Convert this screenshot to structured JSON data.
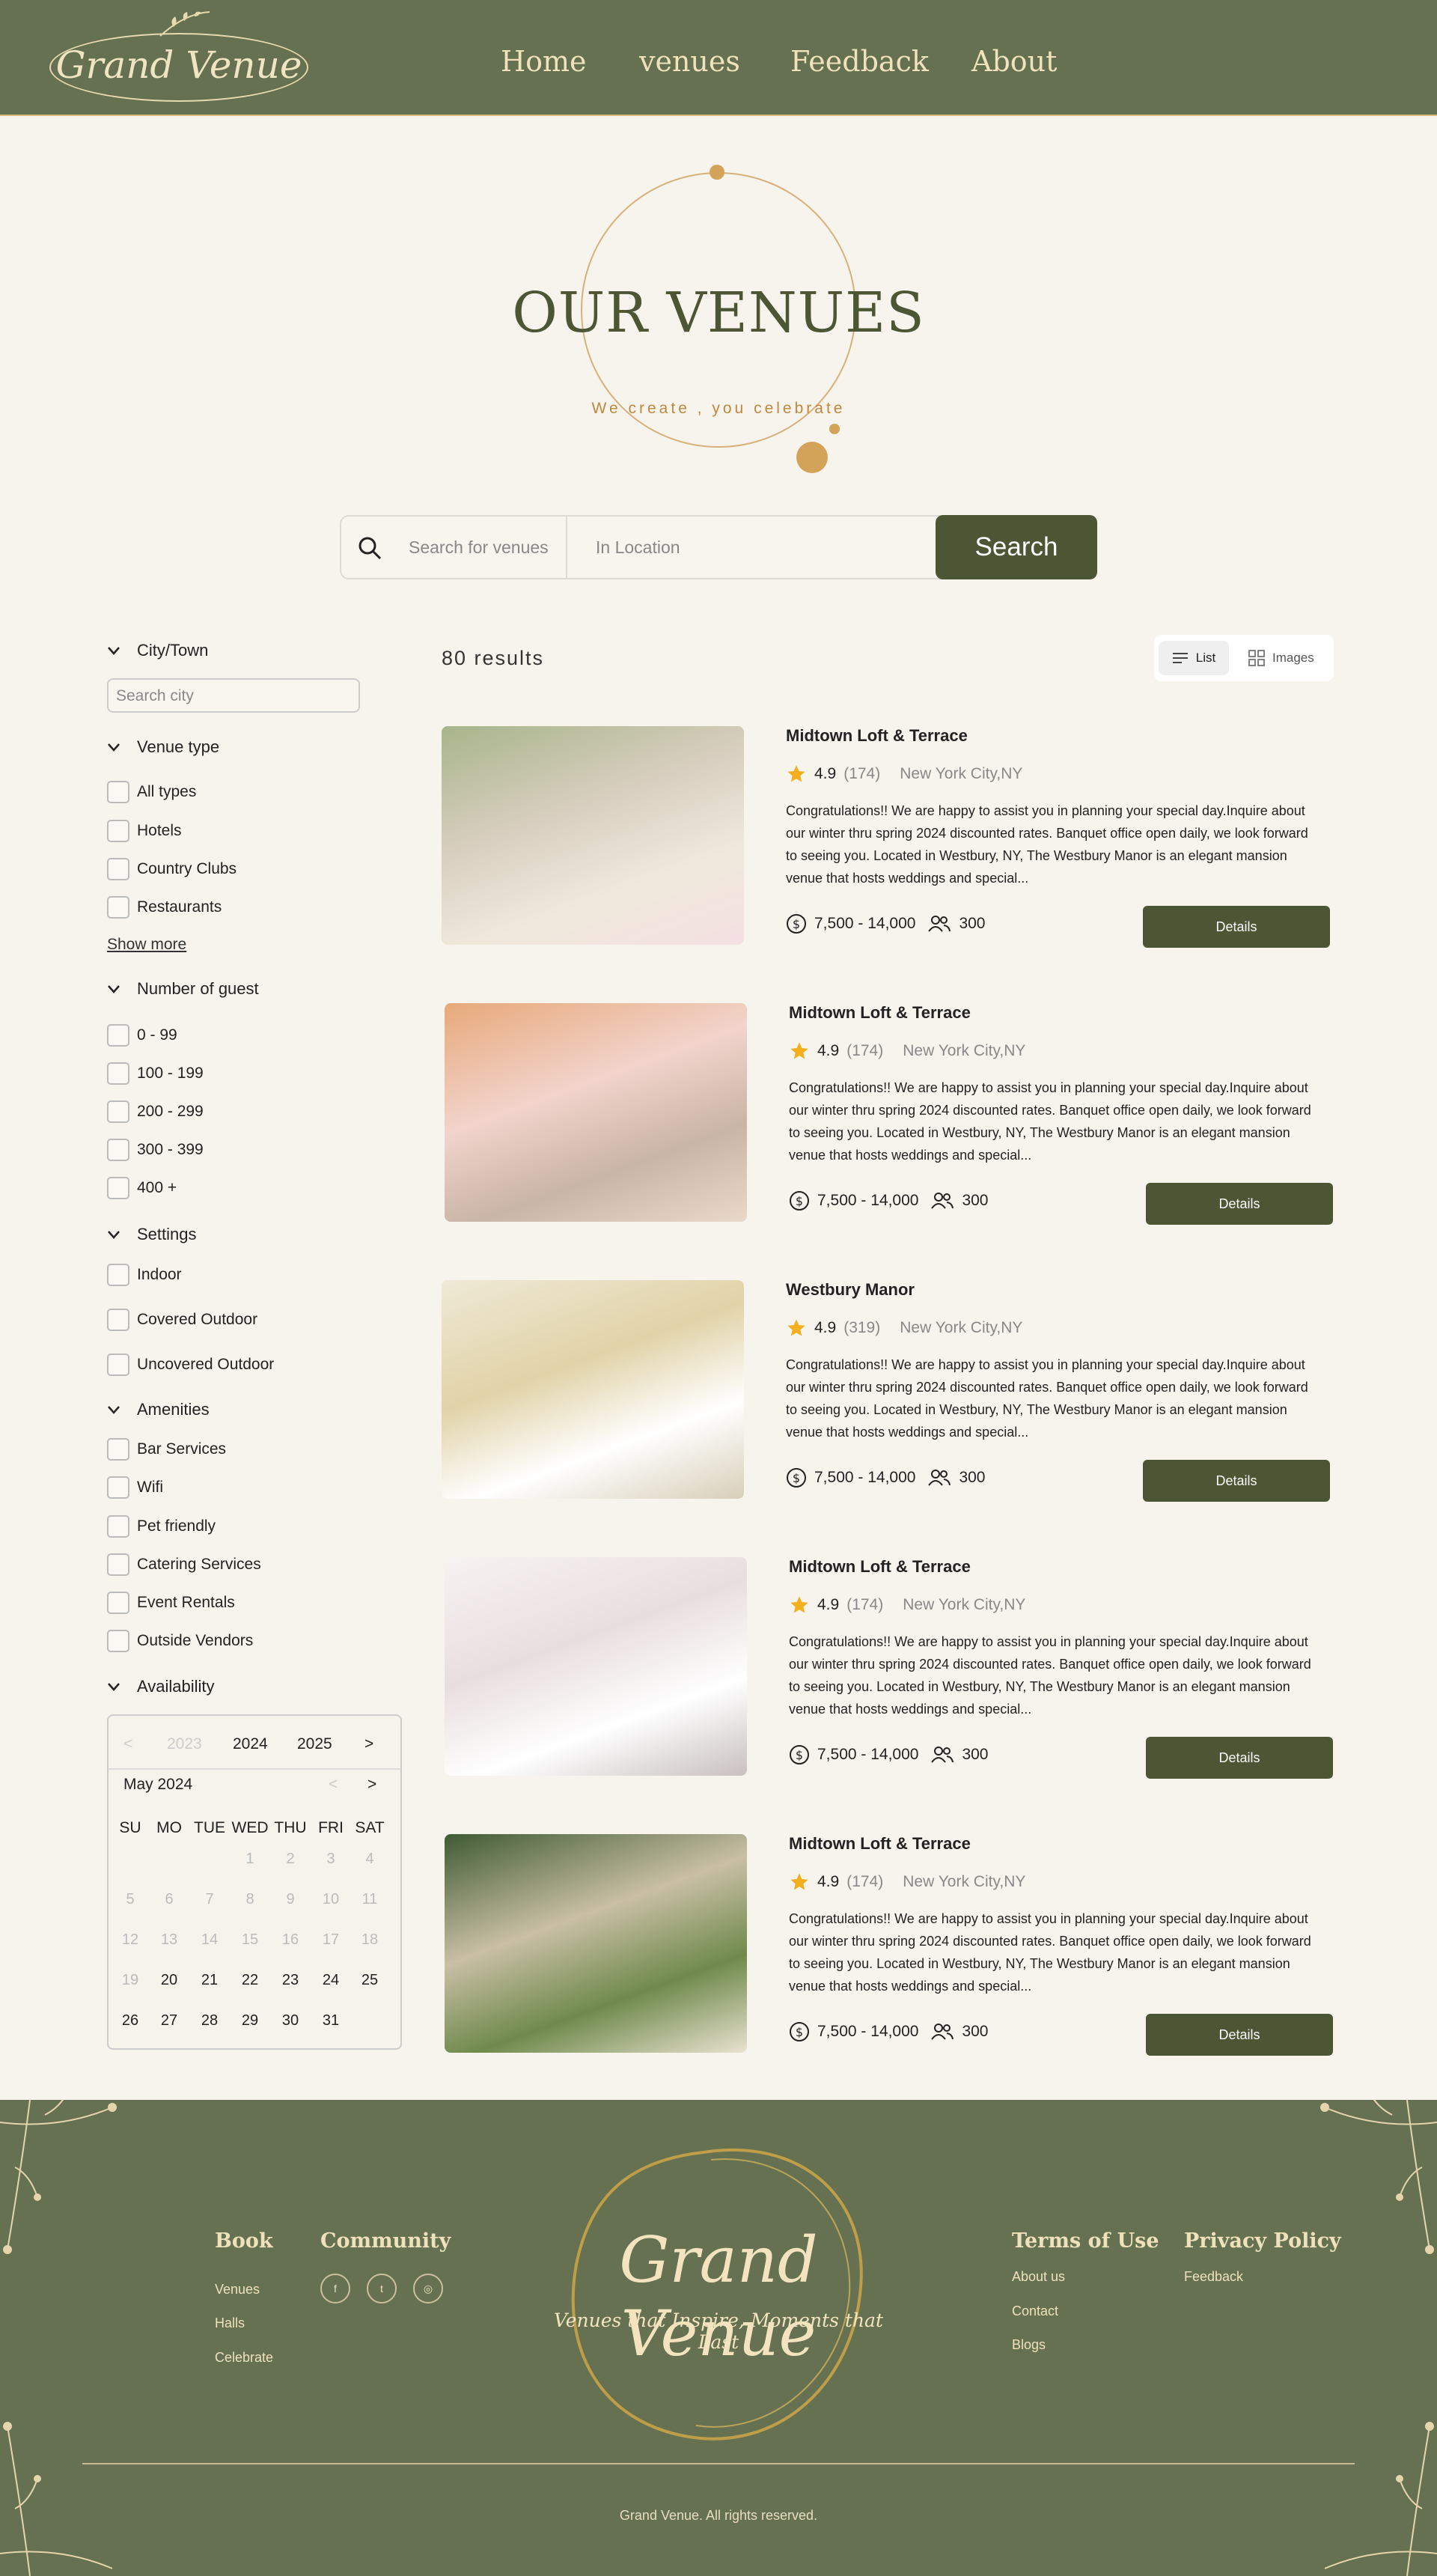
{
  "brand": {
    "name": "Grand Venue"
  },
  "nav": [
    "Home",
    "venues",
    "Feedback",
    "About"
  ],
  "hero": {
    "title": "OUR VENUES",
    "subtitle": "We create , you celebrate"
  },
  "search": {
    "venue_placeholder": "Search for venues",
    "location_placeholder": "In Location",
    "button": "Search"
  },
  "filters": {
    "city": {
      "title": "City/Town",
      "placeholder": "Search city"
    },
    "venue_type": {
      "title": "Venue type",
      "options": [
        "All types",
        "Hotels",
        "Country Clubs",
        "Restaurants"
      ],
      "show_more": "Show more"
    },
    "guests": {
      "title": "Number of guest",
      "options": [
        "0  -  99",
        "100  -  199",
        "200  -  299",
        "300  -  399",
        "400 +"
      ]
    },
    "settings": {
      "title": "Settings",
      "options": [
        "Indoor",
        "Covered Outdoor",
        "Uncovered Outdoor"
      ]
    },
    "amenities": {
      "title": "Amenities",
      "options": [
        "Bar Services",
        "Wifi",
        "Pet friendly",
        "Catering Services",
        "Event Rentals",
        "Outside Vendors"
      ]
    },
    "availability": {
      "title": "Availability"
    }
  },
  "calendar": {
    "years": [
      "2023",
      "2024",
      "2025"
    ],
    "month": "May 2024",
    "weekdays": [
      "SU",
      "MO",
      "TUE",
      "WED",
      "THU",
      "FRI",
      "SAT"
    ],
    "days": [
      [
        "",
        "",
        "",
        "1",
        "2",
        "3",
        "4"
      ],
      [
        "5",
        "6",
        "7",
        "8",
        "9",
        "10",
        "11"
      ],
      [
        "12",
        "13",
        "14",
        "15",
        "16",
        "17",
        "18"
      ],
      [
        "19",
        "20",
        "21",
        "22",
        "23",
        "24",
        "25"
      ],
      [
        "26",
        "27",
        "28",
        "29",
        "30",
        "31",
        ""
      ]
    ],
    "first_available_day": 20
  },
  "results": {
    "count": "80 results",
    "view_list": "List",
    "view_images": "Images",
    "venues": [
      {
        "name": "Midtown Loft & Terrace",
        "rating": "4.9",
        "reviews": "(174)",
        "location": "New York City,NY",
        "description": "Congratulations!! We are happy to assist you in planning your special day.Inquire about our winter thru spring 2024 discounted rates. Banquet office open daily, we look forward to seeing you. Located in Westbury, NY, The Westbury Manor is an elegant mansion venue that hosts weddings and special...",
        "price": "7,500 - 14,000",
        "capacity": "300",
        "button": "Details"
      },
      {
        "name": "Midtown Loft & Terrace",
        "rating": "4.9",
        "reviews": "(174)",
        "location": "New York City,NY",
        "description": "Congratulations!! We are happy to assist you in planning your special day.Inquire about our winter thru spring 2024 discounted rates. Banquet office open daily, we look forward to seeing you. Located in Westbury, NY, The Westbury Manor is an elegant mansion venue that hosts weddings and special...",
        "price": "7,500 - 14,000",
        "capacity": "300",
        "button": "Details"
      },
      {
        "name": "Westbury Manor",
        "rating": "4.9",
        "reviews": "(319)",
        "location": "New York City,NY",
        "description": "Congratulations!! We are happy to assist you in planning your special day.Inquire about our winter thru spring 2024 discounted rates. Banquet office open daily, we look forward to seeing you. Located in Westbury, NY, The Westbury Manor is an elegant mansion venue that hosts weddings and special...",
        "price": "7,500 - 14,000",
        "capacity": "300",
        "button": "Details"
      },
      {
        "name": "Midtown Loft & Terrace",
        "rating": "4.9",
        "reviews": "(174)",
        "location": "New York City,NY",
        "description": "Congratulations!! We are happy to assist you in planning your special day.Inquire about our winter thru spring 2024 discounted rates. Banquet office open daily, we look forward to seeing you. Located in Westbury, NY, The Westbury Manor is an elegant mansion venue that hosts weddings and special...",
        "price": "7,500 - 14,000",
        "capacity": "300",
        "button": "Details"
      },
      {
        "name": "Midtown Loft & Terrace",
        "rating": "4.9",
        "reviews": "(174)",
        "location": "New York City,NY",
        "description": "Congratulations!! We are happy to assist you in planning your special day.Inquire about our winter thru spring 2024 discounted rates. Banquet office open daily, we look forward to seeing you. Located in Westbury, NY, The Westbury Manor is an elegant mansion venue that hosts weddings and special...",
        "price": "7,500 - 14,000",
        "capacity": "300",
        "button": "Details"
      }
    ]
  },
  "footer": {
    "book": {
      "title": "Book",
      "links": [
        "Venues",
        "Halls",
        "Celebrate"
      ]
    },
    "community": {
      "title": "Community",
      "social": [
        "f",
        "t",
        "◎"
      ]
    },
    "logo": {
      "name": "Grand Venue",
      "tagline": "Venues that Inspire, Moments that Last"
    },
    "terms": {
      "title": "Terms of Use",
      "links": [
        "About us",
        "Contact",
        "Blogs"
      ]
    },
    "privacy": {
      "title": "Privacy Policy",
      "links": [
        "Feedback"
      ]
    },
    "copyright": "Grand Venue. All rights reserved."
  },
  "colors": {
    "brand_green": "#657151",
    "dark_green": "#4c5634",
    "gold": "#d4a35a",
    "cream": "#f6f4ec",
    "star": "#f2b01e"
  },
  "icons": [
    "search-icon",
    "chevron-down-icon",
    "star-icon",
    "dollar-icon",
    "people-icon",
    "list-icon",
    "grid-icon",
    "chevron-left-icon",
    "chevron-right-icon"
  ]
}
